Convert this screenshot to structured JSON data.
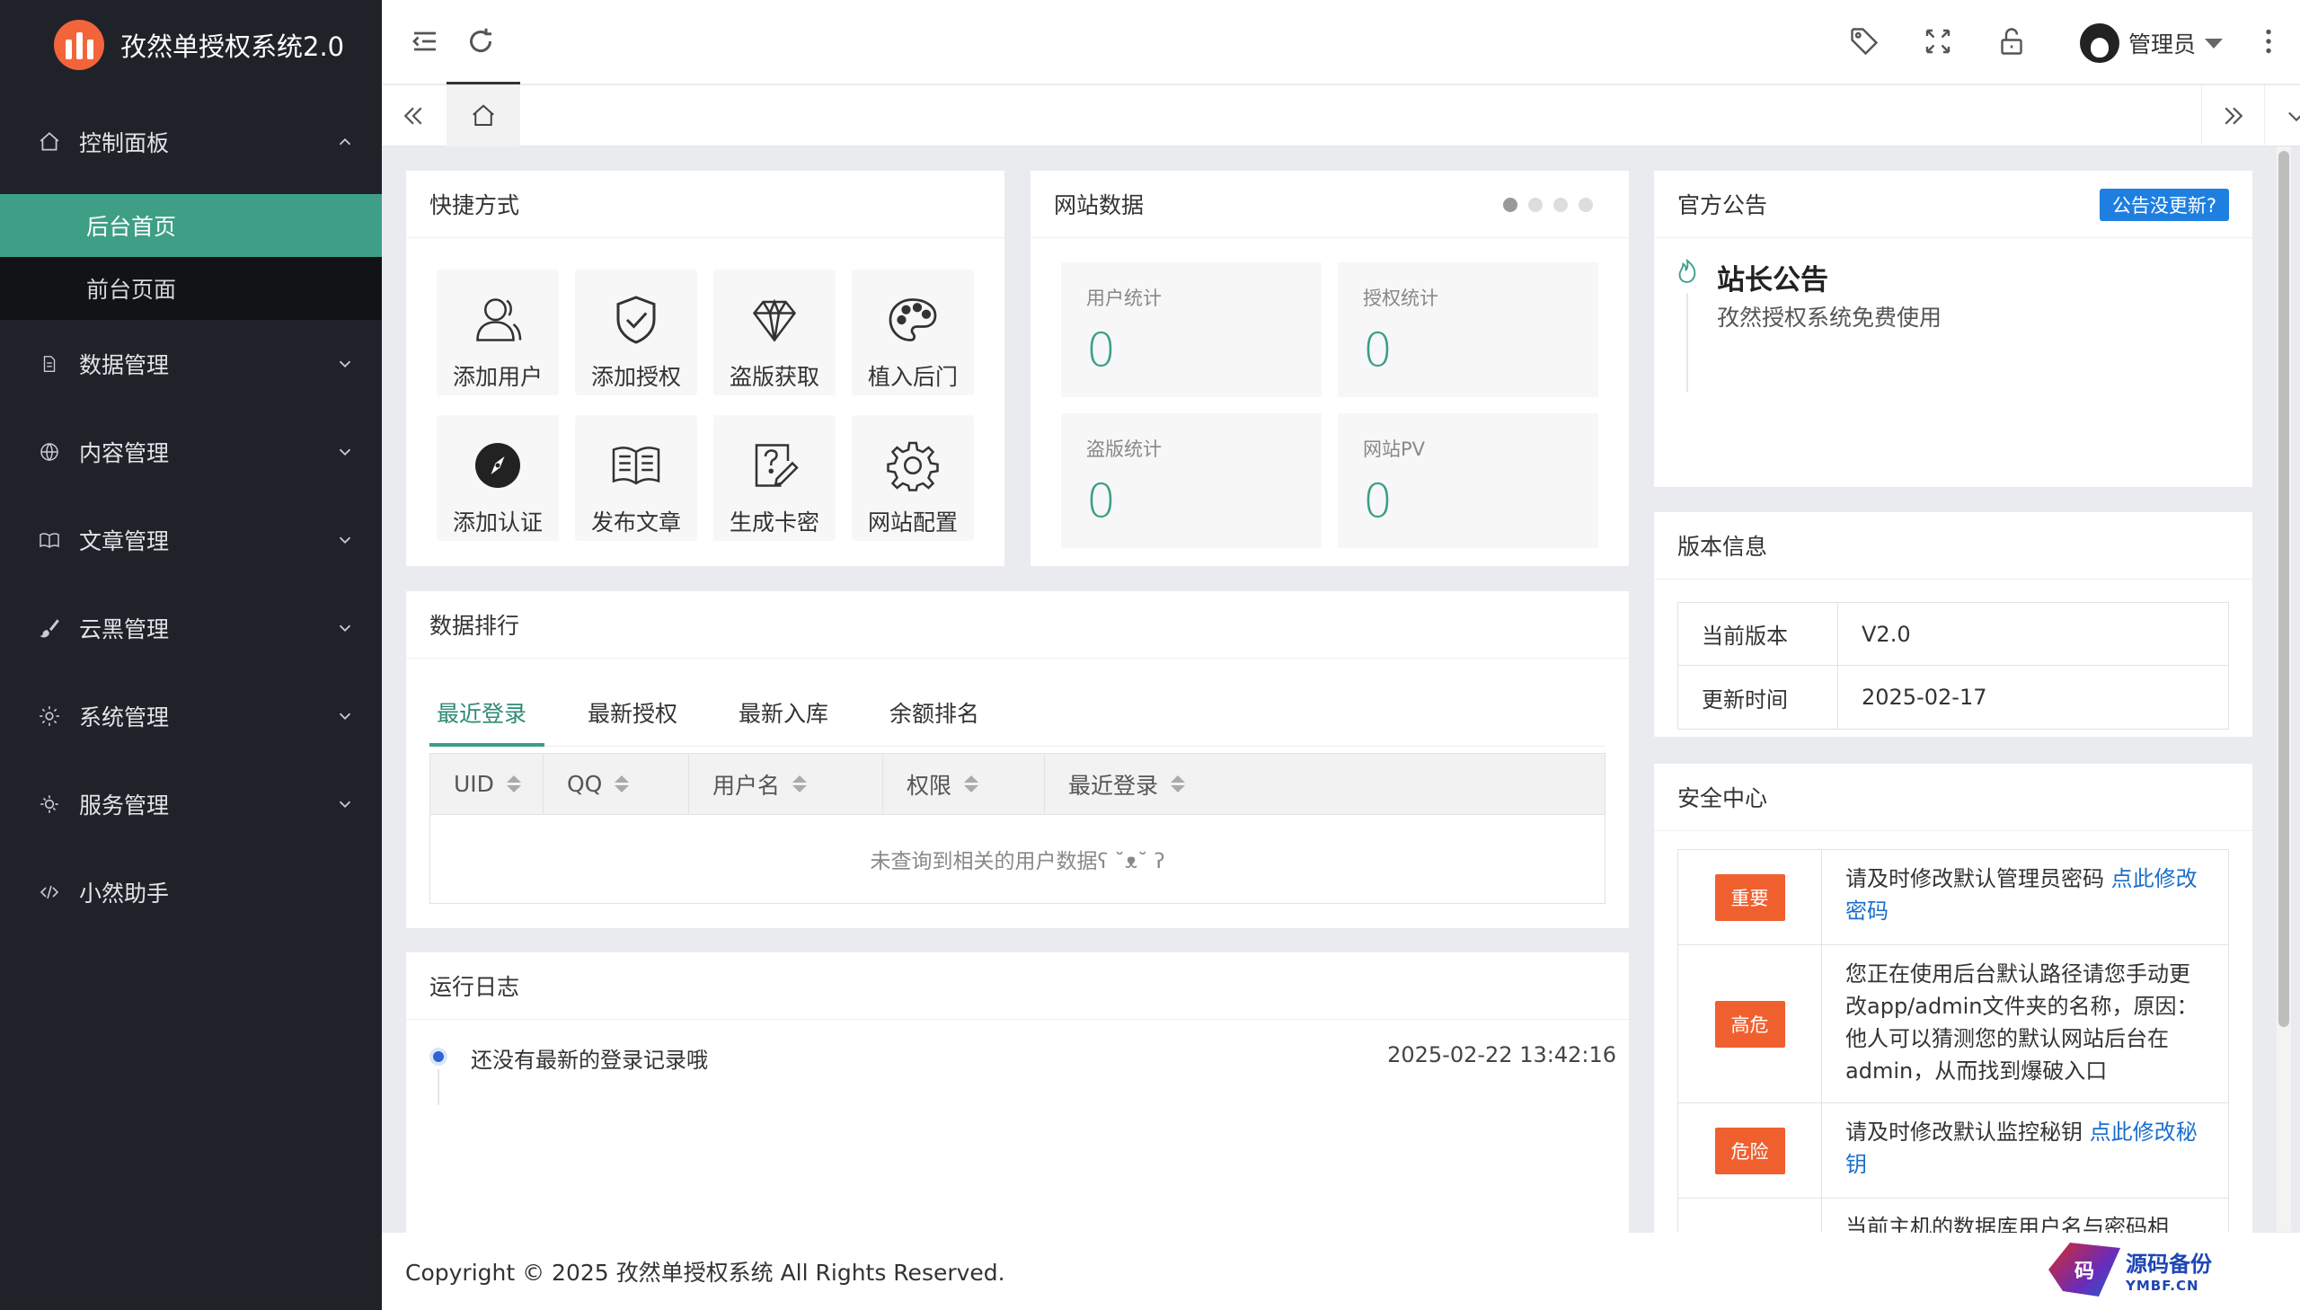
{
  "app": {
    "title": "孜然单授权系统2.0"
  },
  "sidebar": {
    "items": [
      {
        "label": "控制面板",
        "icon": "home-icon",
        "expanded": true,
        "children": [
          {
            "label": "后台首页",
            "active": true
          },
          {
            "label": "前台页面"
          }
        ]
      },
      {
        "label": "数据管理",
        "icon": "file-icon"
      },
      {
        "label": "内容管理",
        "icon": "globe-icon"
      },
      {
        "label": "文章管理",
        "icon": "book-icon"
      },
      {
        "label": "云黑管理",
        "icon": "brush-icon"
      },
      {
        "label": "系统管理",
        "icon": "gear-icon"
      },
      {
        "label": "服务管理",
        "icon": "service-icon"
      },
      {
        "label": "小然助手",
        "icon": "code-icon"
      }
    ]
  },
  "header": {
    "user_name": "管理员"
  },
  "quick": {
    "title": "快捷方式",
    "items": [
      {
        "label": "添加用户",
        "icon": "user-icon"
      },
      {
        "label": "添加授权",
        "icon": "shield-check-icon"
      },
      {
        "label": "盗版获取",
        "icon": "diamond-icon"
      },
      {
        "label": "植入后门",
        "icon": "palette-icon"
      },
      {
        "label": "添加认证",
        "icon": "compass-icon"
      },
      {
        "label": "发布文章",
        "icon": "open-book-icon"
      },
      {
        "label": "生成卡密",
        "icon": "question-edit-icon"
      },
      {
        "label": "网站配置",
        "icon": "cog-icon"
      }
    ]
  },
  "site": {
    "title": "网站数据",
    "stats": [
      {
        "label": "用户统计",
        "value": "0"
      },
      {
        "label": "授权统计",
        "value": "0"
      },
      {
        "label": "盗版统计",
        "value": "0"
      },
      {
        "label": "网站PV",
        "value": "0"
      }
    ]
  },
  "ranking": {
    "title": "数据排行",
    "tabs": [
      "最近登录",
      "最新授权",
      "最新入库",
      "余额排名"
    ],
    "columns": [
      "UID",
      "QQ",
      "用户名",
      "权限",
      "最近登录"
    ],
    "empty": "未查询到相关的用户数据ʕ ˘ᴥ˘ ʔ"
  },
  "log": {
    "title": "运行日志",
    "entries": [
      {
        "text": "还没有最新的登录记录哦",
        "time": "2025-02-22 13:42:16"
      }
    ]
  },
  "announce": {
    "title": "官方公告",
    "button": "公告没更新?",
    "heading": "站长公告",
    "text": "孜然授权系统免费使用"
  },
  "version": {
    "title": "版本信息",
    "rows": [
      {
        "k": "当前版本",
        "v": "V2.0"
      },
      {
        "k": "更新时间",
        "v": "2025-02-17"
      }
    ]
  },
  "security": {
    "title": "安全中心",
    "rows": [
      {
        "level": "重要",
        "text": "请及时修改默认管理员密码 ",
        "link": "点此修改密码"
      },
      {
        "level": "高危",
        "text": "您正在使用后台默认路径请您手动更改app/admin文件夹的名称，原因：他人可以猜测您的默认网站后台在admin，从而找到爆破入口",
        "link": ""
      },
      {
        "level": "危险",
        "text": "请及时修改默认监控秘钥 ",
        "link": "点此修改秘钥"
      },
      {
        "level": "",
        "text": "当前主机的数据库用户名与密码相",
        "link": ""
      }
    ]
  },
  "footer": {
    "text": "Copyright © 2025 孜然单授权系统 All Rights Reserved."
  },
  "watermark": {
    "icon_text": "码",
    "main": "源码备份",
    "sub": "YMBF.CN"
  },
  "colors": {
    "sidebar": "#20222a",
    "accent": "#3a9e87",
    "active_sub": "#3f9f86",
    "danger": "#f0602f",
    "link": "#1a6fcb",
    "notice_btn": "#1e7fe0"
  }
}
